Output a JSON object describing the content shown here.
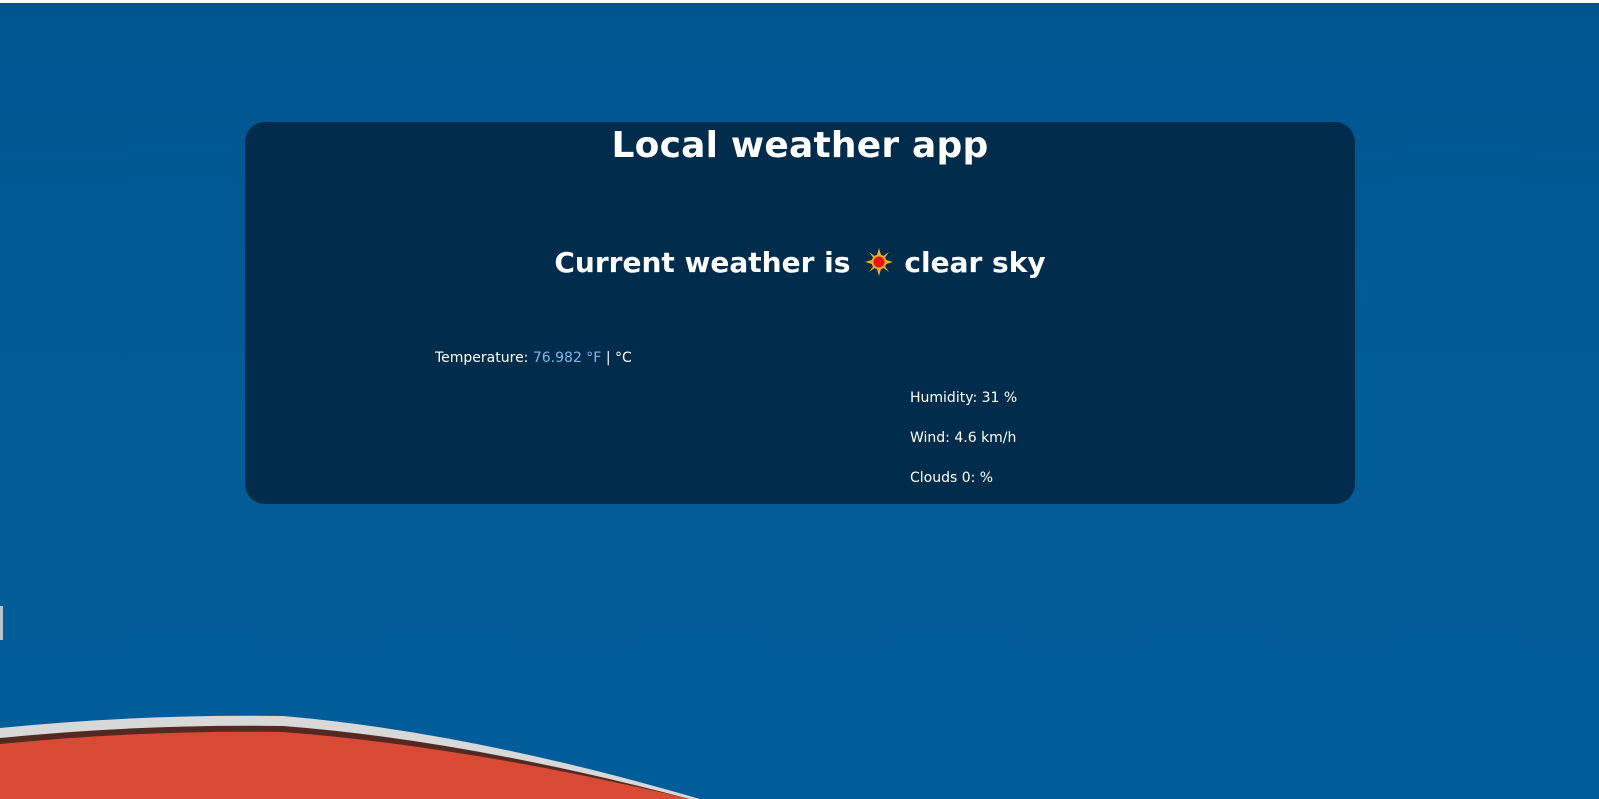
{
  "app": {
    "title": "Local weather app"
  },
  "current": {
    "prefix": "Current weather is",
    "icon": "sun-icon",
    "description": "clear sky"
  },
  "temperature": {
    "label": "Temperature:",
    "value_f": "76.982 °F",
    "separator": "|",
    "unit_c": "°C"
  },
  "stats": {
    "humidity": "Humidity: 31 %",
    "wind": "Wind: 4.6 km/h",
    "clouds": "Clouds 0: %"
  },
  "colors": {
    "background": "#005a96",
    "card": "#022c4b",
    "link": "#85b4ec",
    "roof": "#d94a35"
  }
}
